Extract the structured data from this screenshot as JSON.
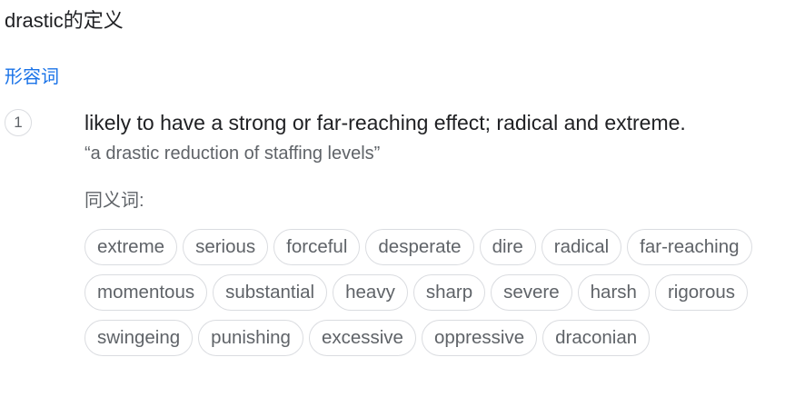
{
  "heading": {
    "title": "drastic的定义"
  },
  "part_of_speech": "形容词",
  "sense": {
    "number": "1",
    "definition": "likely to have a strong or far-reaching effect; radical and extreme.",
    "example": "“a drastic reduction of staffing levels”",
    "synonyms_label": "同义词:",
    "synonyms": [
      "extreme",
      "serious",
      "forceful",
      "desperate",
      "dire",
      "radical",
      "far-reaching",
      "momentous",
      "substantial",
      "heavy",
      "sharp",
      "severe",
      "harsh",
      "rigorous",
      "swingeing",
      "punishing",
      "excessive",
      "oppressive",
      "draconian"
    ]
  }
}
